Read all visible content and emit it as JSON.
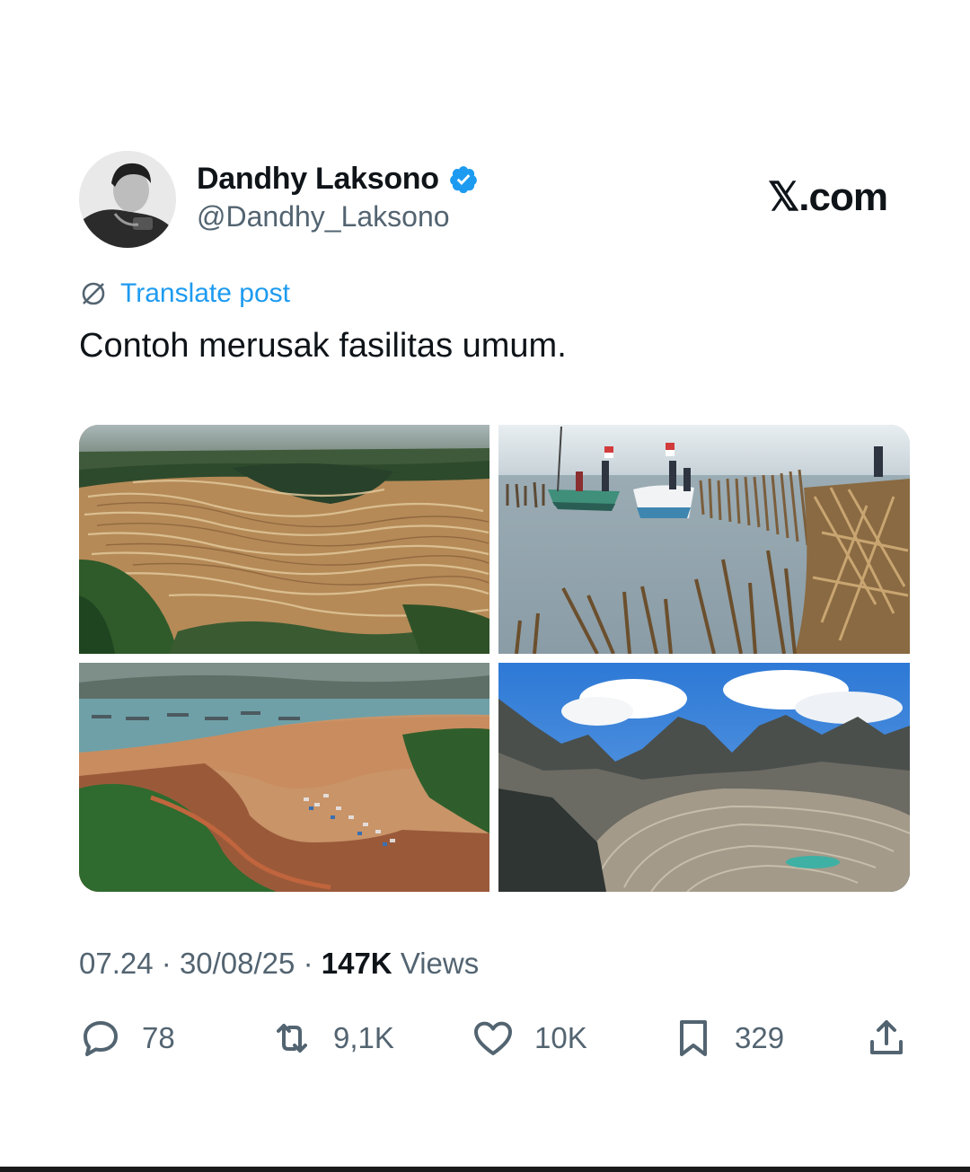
{
  "author": {
    "name": "Dandhy Laksono",
    "handle": "@Dandhy_Laksono",
    "verified": true,
    "verified_color": "#1d9bf0"
  },
  "brand": "𝕏.com",
  "translate_label": "Translate post",
  "post_text": "Contoh merusak fasilitas umum.",
  "media": [
    {
      "icon": "deforested-hills-photo"
    },
    {
      "icon": "bamboo-sea-fence-boats-photo"
    },
    {
      "icon": "muddy-coastal-bay-photo"
    },
    {
      "icon": "open-pit-mine-photo"
    }
  ],
  "meta": {
    "time": "07.24",
    "separator": "·",
    "date": "30/08/25",
    "views_count": "147K",
    "views_label": "Views"
  },
  "actions": {
    "replies": "78",
    "reposts": "9,1K",
    "likes": "10K",
    "bookmarks": "329"
  },
  "colors": {
    "text": "#0f1419",
    "secondary": "#536471",
    "link": "#1d9bf0"
  }
}
